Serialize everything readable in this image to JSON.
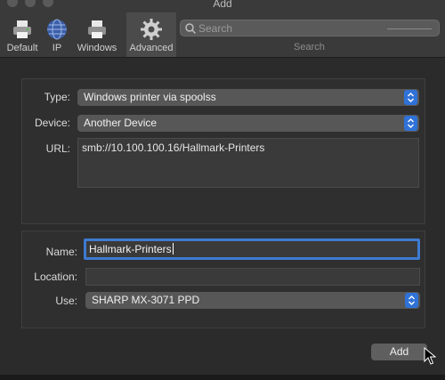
{
  "window": {
    "title": "Add"
  },
  "toolbar": {
    "items": [
      {
        "label": "Default",
        "icon": "printer-icon"
      },
      {
        "label": "IP",
        "icon": "globe-icon"
      },
      {
        "label": "Windows",
        "icon": "windows-printer-icon"
      },
      {
        "label": "Advanced",
        "icon": "gear-icon",
        "active": true
      }
    ],
    "search": {
      "placeholder": "Search",
      "label": "Search"
    }
  },
  "connection": {
    "type_label": "Type:",
    "type_value": "Windows printer via spoolss",
    "device_label": "Device:",
    "device_value": "Another Device",
    "url_label": "URL:",
    "url_value": "smb://10.100.100.16/Hallmark-Printers"
  },
  "details": {
    "name_label": "Name:",
    "name_value": "Hallmark-Printers",
    "location_label": "Location:",
    "location_value": "",
    "use_label": "Use:",
    "use_value": "SHARP MX-3071 PPD"
  },
  "actions": {
    "add_label": "Add"
  },
  "colors": {
    "accent": "#2f72d8",
    "focus_ring": "#3e7bd1",
    "background": "#2b2b2b"
  }
}
